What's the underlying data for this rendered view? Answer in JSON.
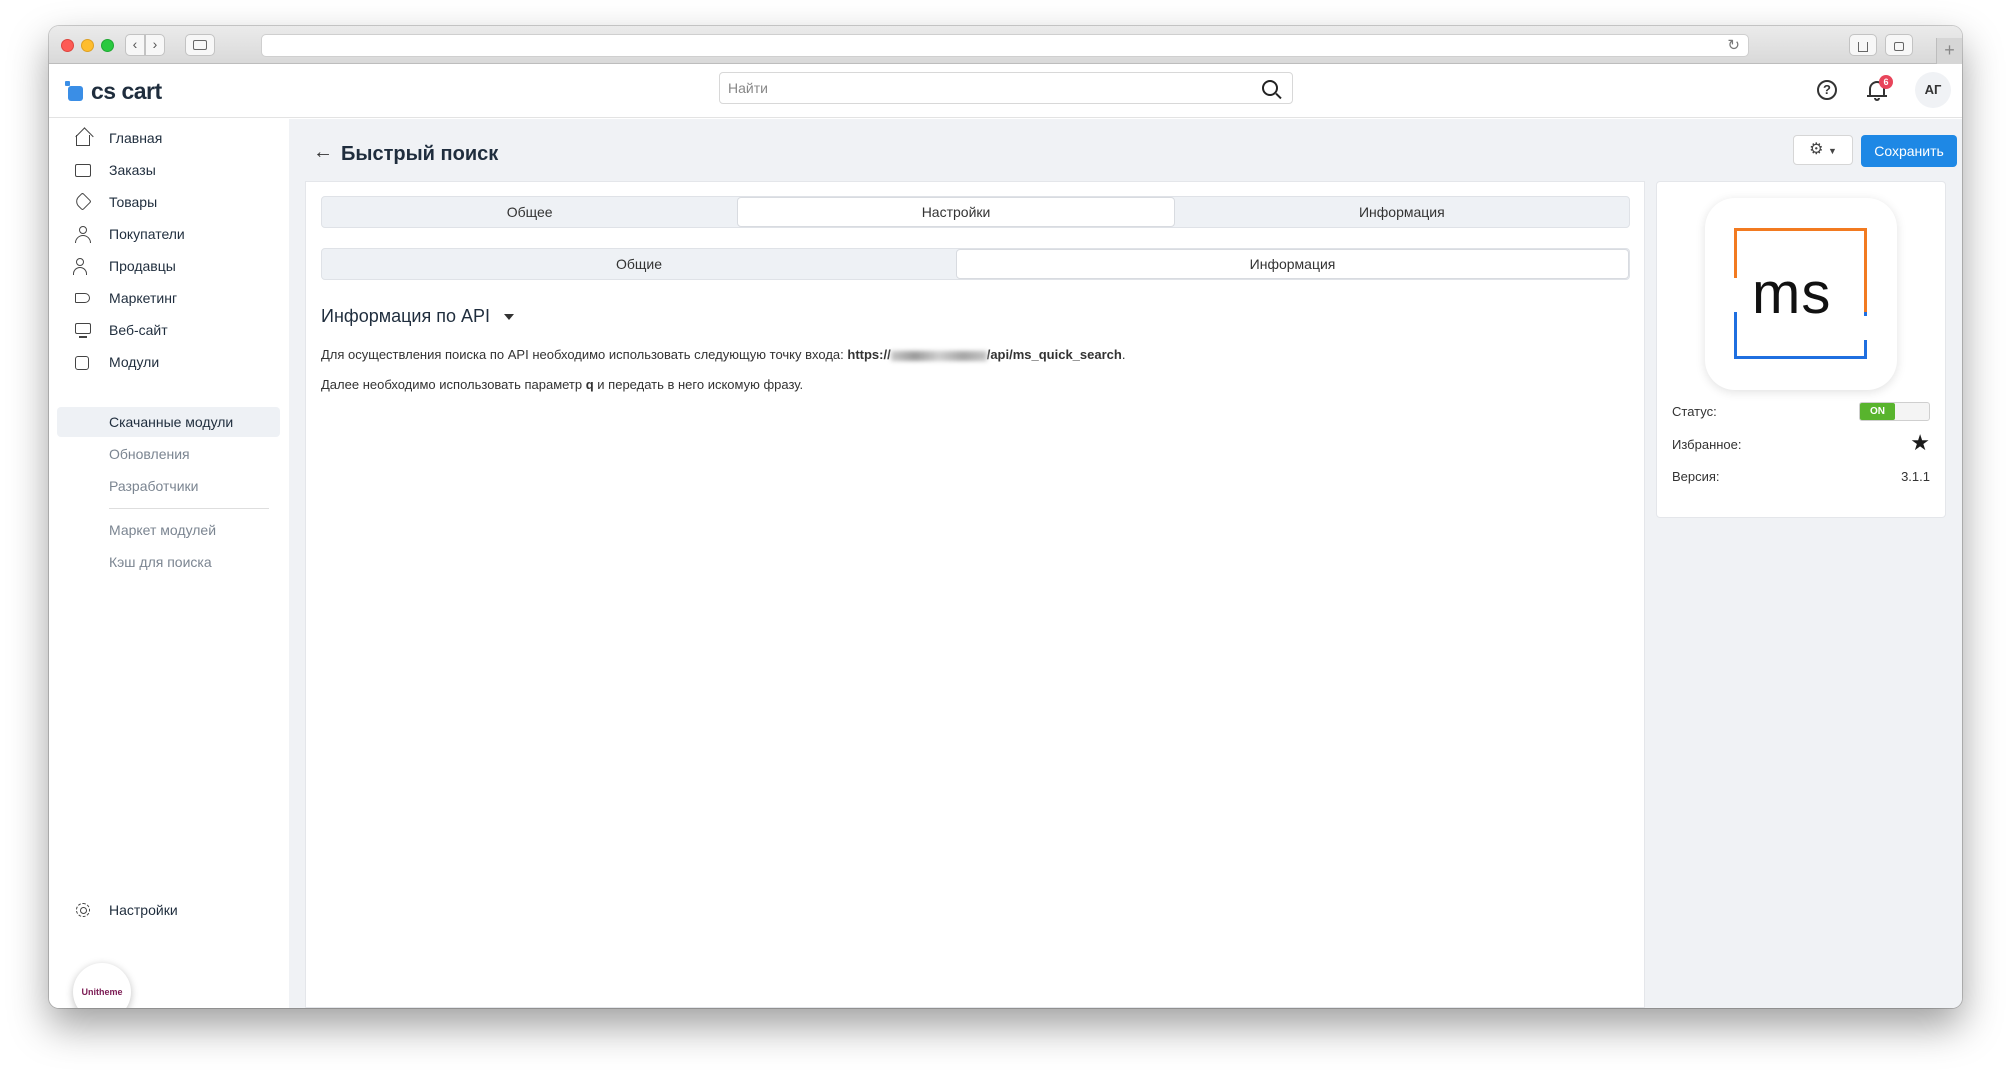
{
  "browser": {
    "back_label": "‹",
    "forward_label": "›",
    "reload_label": "↻",
    "new_tab_label": "+"
  },
  "header": {
    "logo_text": "cs cart",
    "search_placeholder": "Найти",
    "help_label": "?",
    "notifications_count": "6",
    "avatar_initials": "АГ"
  },
  "sidebar": {
    "items": [
      {
        "label": "Главная",
        "icon": "home-icon"
      },
      {
        "label": "Заказы",
        "icon": "inbox-icon"
      },
      {
        "label": "Товары",
        "icon": "tag-icon"
      },
      {
        "label": "Покупатели",
        "icon": "user-icon"
      },
      {
        "label": "Продавцы",
        "icon": "users-icon"
      },
      {
        "label": "Маркетинг",
        "icon": "megaphone-icon"
      },
      {
        "label": "Веб-сайт",
        "icon": "monitor-icon"
      },
      {
        "label": "Модули",
        "icon": "puzzle-icon"
      }
    ],
    "subitems": [
      {
        "label": "Скачанные модули",
        "active": true
      },
      {
        "label": "Обновления",
        "active": false
      },
      {
        "label": "Разработчики",
        "active": false
      }
    ],
    "extra_items": [
      {
        "label": "Маркет модулей"
      },
      {
        "label": "Кэш для поиска"
      }
    ],
    "settings_label": "Настройки",
    "unitheme_label": "Unitheme"
  },
  "page": {
    "title": "Быстрый поиск",
    "save_label": "Сохранить",
    "tabs": [
      {
        "label": "Общее",
        "active": false
      },
      {
        "label": "Настройки",
        "active": true
      },
      {
        "label": "Информация",
        "active": false
      }
    ],
    "subtabs": [
      {
        "label": "Общие",
        "active": false
      },
      {
        "label": "Информация",
        "active": true
      }
    ],
    "section_title": "Информация по API",
    "line1_text": "Для осуществления поиска по API необходимо использовать следующую точку входа: ",
    "line1_url_prefix": "https://",
    "line1_url_suffix": "/api/ms_quick_search",
    "line1_end": ".",
    "line2_before": "Далее необходимо использовать параметр ",
    "line2_param": "q",
    "line2_after": " и передать в него искомую фразу."
  },
  "addon_card": {
    "logo_text": "ms",
    "status_label": "Статус:",
    "status_value": "ON",
    "favorite_label": "Избранное:",
    "version_label": "Версия:",
    "version_value": "3.1.1"
  },
  "colors": {
    "accent": "#1e88e5",
    "status_on": "#58b42d",
    "logo_orange": "#f27a20",
    "logo_blue": "#1f6fe0",
    "badge": "#e8445a"
  }
}
